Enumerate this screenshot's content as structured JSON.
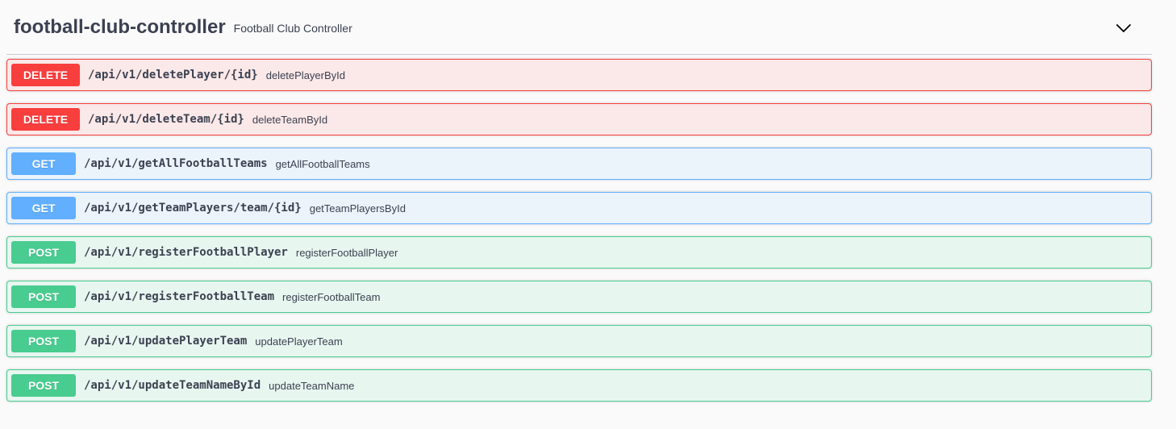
{
  "tag": {
    "name": "football-club-controller",
    "description": "Football Club Controller",
    "toggle_icon": "chevron-down-icon"
  },
  "colors": {
    "delete": "#f93e3e",
    "get": "#61affe",
    "post": "#49cc90"
  },
  "operations": [
    {
      "method": "DELETE",
      "path": "/api/v1/deletePlayer/{id}",
      "summary": "deletePlayerById"
    },
    {
      "method": "DELETE",
      "path": "/api/v1/deleteTeam/{id}",
      "summary": "deleteTeamById"
    },
    {
      "method": "GET",
      "path": "/api/v1/getAllFootballTeams",
      "summary": "getAllFootballTeams"
    },
    {
      "method": "GET",
      "path": "/api/v1/getTeamPlayers/team/{id}",
      "summary": "getTeamPlayersById"
    },
    {
      "method": "POST",
      "path": "/api/v1/registerFootballPlayer",
      "summary": "registerFootballPlayer"
    },
    {
      "method": "POST",
      "path": "/api/v1/registerFootballTeam",
      "summary": "registerFootballTeam"
    },
    {
      "method": "POST",
      "path": "/api/v1/updatePlayerTeam",
      "summary": "updatePlayerTeam"
    },
    {
      "method": "POST",
      "path": "/api/v1/updateTeamNameById",
      "summary": "updateTeamName"
    }
  ]
}
